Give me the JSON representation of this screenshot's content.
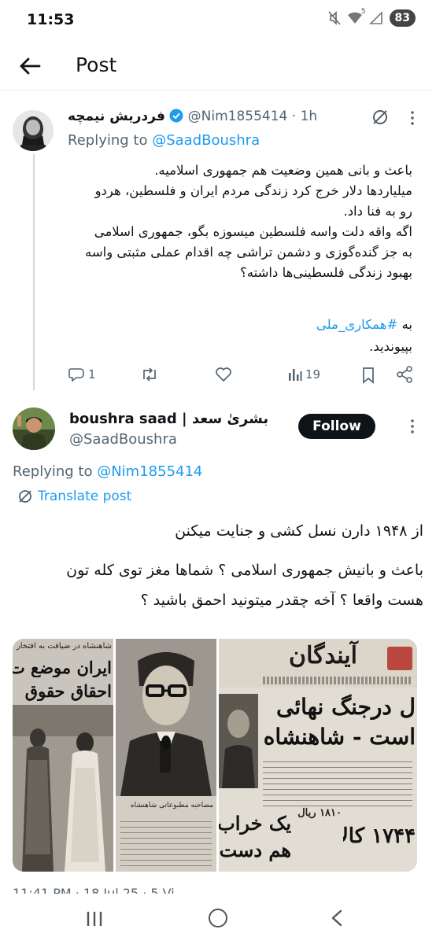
{
  "status_bar": {
    "time": "11:53",
    "battery": "83",
    "network": "5"
  },
  "app_bar": {
    "title": "Post"
  },
  "reply_tweet": {
    "display_name": "فردریش نیمچه",
    "handle_time": "@Nim1855414 · 1h",
    "replying_prefix": "Replying to",
    "replying_to": "@SaadBoushra",
    "body_lines": [
      "باعث و بانی همین وضعیت هم جمهوری اسلامیه.",
      "میلیاردها دلار خرج کرد زندگی مردم ایران و فلسطین، هردو",
      "رو به فنا داد.",
      "اگه واقه دلت واسه فلسطین میسوزه بگو، جمهوری اسلامی",
      "به جز گنده‌گوزی و دشمن تراشی چه اقدام عملی مثبتی واسه",
      "بهبود زندگی فلسطینی‌ها داشته؟"
    ],
    "hashtag_prefix": "به",
    "hashtag": "#همکاری_ملی",
    "hashtag_suffix": "بپیوندید.",
    "replies": "1",
    "views": "19"
  },
  "main_tweet": {
    "display_name": "boushra saad | بشریٰ سعد",
    "handle": "@SaadBoushra",
    "follow_label": "Follow",
    "replying_prefix": "Replying to",
    "replying_to": "@Nim1855414",
    "translate_label": "Translate post",
    "body_lines": [
      "از ۱۹۴۸ دارن نسل کشی و جنایت میکنن",
      "باعث و بانیش جمهوری اسلامی ؟ شماها مغز توی کله تون",
      "هست واقعا ؟ آخه چقدر میتونید احمق باشید ؟"
    ],
    "timestamp_partial": "11:41 PM · 18 Jul 25 · 5 Vi"
  },
  "newspaper_images": {
    "left": {
      "header": "شاهنشاه در ضیافت به افتخار م",
      "headline_1": "ایران موضع ت",
      "headline_2": "احقاق حقوق"
    },
    "middle": {
      "caption": "مصاحبه مطبوعاتی شاهنشاه"
    },
    "right": {
      "masthead": "آیندگان",
      "headline_1": "ل درجنگ نهائی",
      "headline_2": "است - شاهنشاه",
      "bottom_1": "یک خراب",
      "bottom_2": "هم دست",
      "price": "۱۸۱۰ ریال",
      "big_number": "۱۷۴۴ کالا"
    }
  }
}
